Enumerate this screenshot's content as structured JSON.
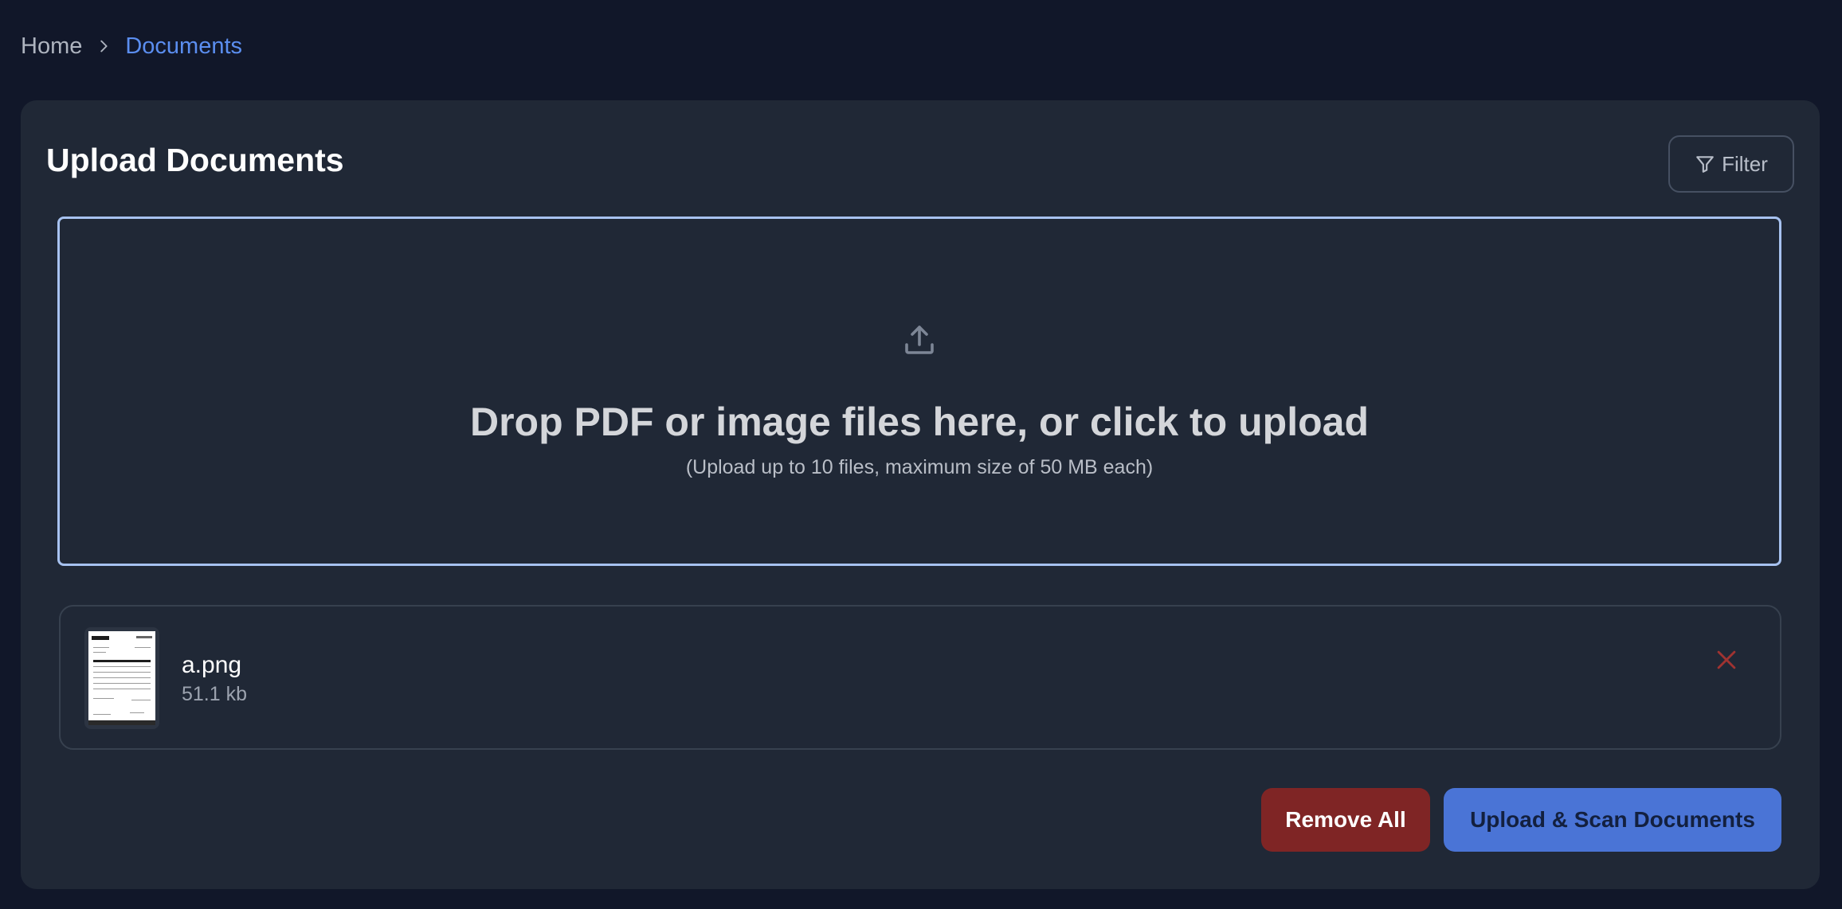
{
  "breadcrumb": {
    "home": "Home",
    "current": "Documents"
  },
  "card": {
    "title": "Upload Documents",
    "filter_label": "Filter"
  },
  "dropzone": {
    "title": "Drop PDF or image files here, or click to upload",
    "subtitle": "(Upload up to 10 files, maximum size of 50 MB each)"
  },
  "files": [
    {
      "name": "a.png",
      "size": "51.1 kb"
    }
  ],
  "actions": {
    "remove_all_label": "Remove All",
    "upload_label": "Upload & Scan Documents"
  },
  "colors": {
    "background": "#111729",
    "card": "#202836",
    "accent": "#5b8ef0",
    "primary_button": "#4a74d6",
    "danger_button": "#7f2525",
    "danger_icon": "#a03331"
  },
  "icons": {
    "breadcrumb_separator": "chevron-right-icon",
    "filter": "funnel-icon",
    "upload": "upload-icon",
    "remove_file": "close-icon"
  }
}
